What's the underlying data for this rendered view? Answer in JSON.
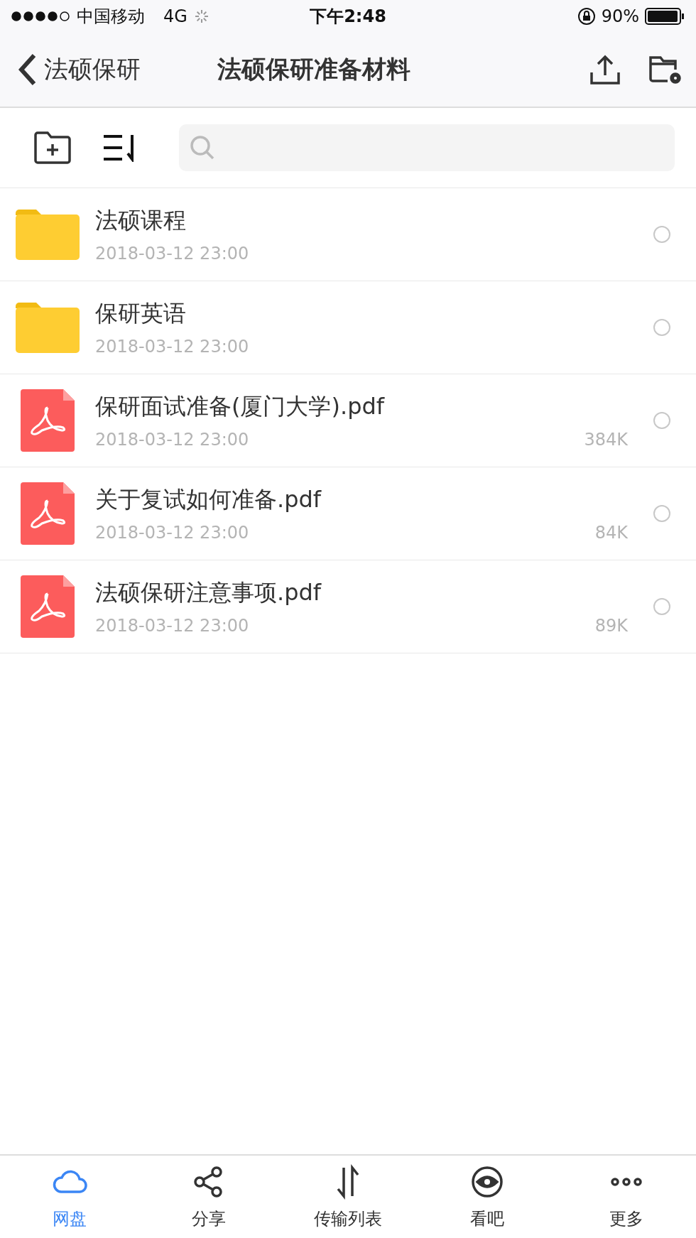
{
  "status_bar": {
    "carrier": "中国移动",
    "network": "4G",
    "time": "下午2:48",
    "battery": "90%"
  },
  "nav_bar": {
    "back_label": "法硕保研",
    "title": "法硕保研准备材料"
  },
  "files": [
    {
      "kind": "folder",
      "name": "法硕课程",
      "date": "2018-03-12 23:00",
      "selected": false
    },
    {
      "kind": "folder",
      "name": "保研英语",
      "date": "2018-03-12 23:00",
      "selected": false
    },
    {
      "kind": "pdf",
      "name": "保研面试准备(厦门大学).pdf",
      "date": "2018-03-12 23:00",
      "size": "384K",
      "selected": false
    },
    {
      "kind": "pdf",
      "name": "关于复试如何准备.pdf",
      "date": "2018-03-12 23:00",
      "size": "84K",
      "selected": false
    },
    {
      "kind": "pdf",
      "name": "法硕保研注意事项.pdf",
      "date": "2018-03-12 23:00",
      "size": "89K",
      "selected": false
    }
  ],
  "tab_bar": [
    {
      "kind": "cloud",
      "label": "网盘",
      "selected": true
    },
    {
      "kind": "share",
      "label": "分享",
      "selected": false
    },
    {
      "kind": "transfer",
      "label": "传输列表",
      "selected": false
    },
    {
      "kind": "eye",
      "label": "看吧",
      "selected": false
    },
    {
      "kind": "more",
      "label": "更多",
      "selected": false
    }
  ]
}
